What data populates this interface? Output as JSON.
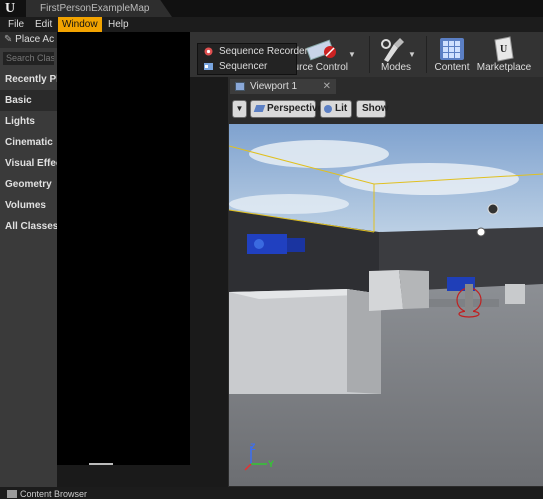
{
  "title_bar": {
    "map_tab": "FirstPersonExampleMap"
  },
  "menu": {
    "items": [
      {
        "label": "File"
      },
      {
        "label": "Edit"
      },
      {
        "label": "Window"
      },
      {
        "label": "Help"
      }
    ],
    "active": "Window"
  },
  "window_menu": {
    "items": [
      {
        "label": "Sequence Recorder",
        "icon": "sequence-recorder-icon"
      },
      {
        "label": "Sequencer",
        "icon": "sequencer-icon"
      }
    ]
  },
  "place_actors": {
    "title": "Place Ac",
    "search_placeholder": "Search Class",
    "categories": [
      {
        "label": "Recently Pla"
      },
      {
        "label": "Basic"
      },
      {
        "label": "Lights"
      },
      {
        "label": "Cinematic"
      },
      {
        "label": "Visual Effect"
      },
      {
        "label": "Geometry"
      },
      {
        "label": "Volumes"
      },
      {
        "label": "All Classes"
      }
    ],
    "selected": "Basic"
  },
  "toolbar": {
    "source_control_label": "ource Control",
    "modes_label": "Modes",
    "content_label": "Content",
    "marketplace_label": "Marketplace"
  },
  "viewport": {
    "tab_label": "Viewport 1",
    "perspective_label": "Perspective",
    "lit_label": "Lit",
    "show_label": "Show",
    "axis_z": "Z",
    "axis_y": "Y"
  },
  "content_browser": {
    "label": "Content Browser"
  },
  "colors": {
    "accent": "#f2a300",
    "sky_top": "#7fa2cf",
    "wall": "#3a3a3a",
    "trigger_outline": "#e0c020"
  }
}
